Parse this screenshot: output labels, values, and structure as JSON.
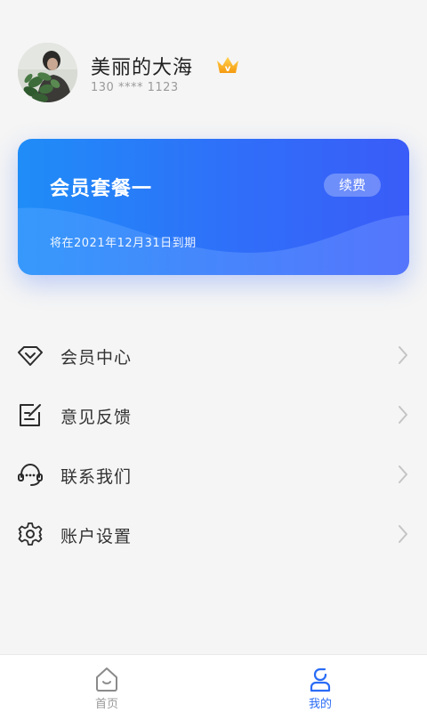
{
  "profile": {
    "name": "美丽的大海",
    "phone": "130 **** 1123",
    "vip_badge": "v"
  },
  "membership_card": {
    "plan_name": "会员套餐一",
    "renew_label": "续费",
    "expiry_text": "将在2021年12月31日到期"
  },
  "menu": {
    "items": [
      {
        "label": "会员中心",
        "icon": "diamond-icon"
      },
      {
        "label": "意见反馈",
        "icon": "feedback-edit-icon"
      },
      {
        "label": "联系我们",
        "icon": "headset-icon"
      },
      {
        "label": "账户设置",
        "icon": "gear-icon"
      }
    ]
  },
  "tabbar": {
    "tabs": [
      {
        "label": "首页",
        "icon": "home-icon",
        "active": false
      },
      {
        "label": "我的",
        "icon": "profile-icon",
        "active": true
      }
    ]
  },
  "colors": {
    "accent": "#2a6cf6",
    "card_gradient_start": "#1f8df7",
    "card_gradient_end": "#3a5cf8",
    "crown": "#f7a81a"
  }
}
